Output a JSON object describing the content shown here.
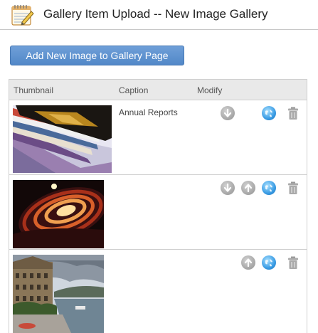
{
  "header": {
    "title": "Gallery Item Upload -- New Image Gallery"
  },
  "toolbar": {
    "add_label": "Add New Image to Gallery Page"
  },
  "table": {
    "columns": {
      "thumbnail": "Thumbnail",
      "caption": "Caption",
      "modify": "Modify"
    },
    "rows": [
      {
        "caption": "Annual Reports",
        "actions": [
          "move-down",
          "web",
          "delete"
        ]
      },
      {
        "caption": "",
        "actions": [
          "move-down",
          "move-up",
          "web",
          "delete"
        ]
      },
      {
        "caption": "",
        "actions": [
          "move-up",
          "web",
          "delete"
        ]
      }
    ]
  },
  "colors": {
    "button": "#5a8fd0",
    "header_bg": "#e9e9e9",
    "border": "#cfcfcf",
    "globe": "#3a9ce4"
  }
}
